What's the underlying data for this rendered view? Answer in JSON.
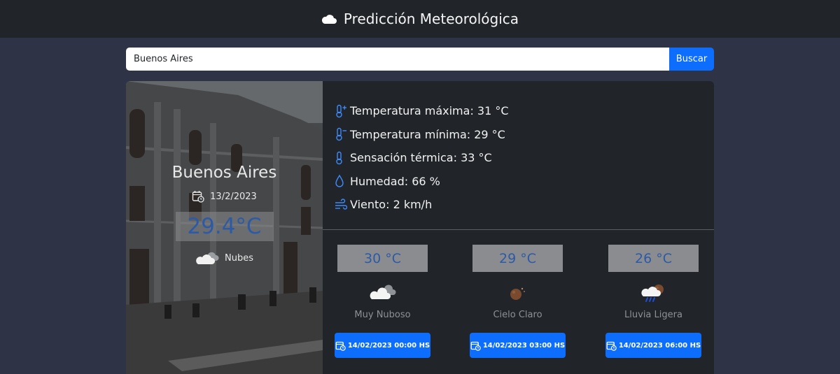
{
  "header": {
    "title": "Predicción Meteorológica",
    "icon": "cloud-icon"
  },
  "search": {
    "value": "Buenos Aires",
    "button_label": "Buscar"
  },
  "current": {
    "city": "Buenos Aires",
    "date": "13/2/2023",
    "temperature": "29.4°C",
    "condition": "Nubes"
  },
  "details": {
    "max_temp": "Temperatura máxima: 31 °C",
    "min_temp": "Temperatura mínima: 29 °C",
    "feels_like": "Sensación térmica: 33 °C",
    "humidity": "Humedad: 66 %",
    "wind": "Viento: 2 km/h"
  },
  "forecast": [
    {
      "temp": "30 °C",
      "desc": "Muy Nuboso",
      "datetime": "14/02/2023 00:00 HS",
      "icon": "broken-clouds-icon"
    },
    {
      "temp": "29 °C",
      "desc": "Cielo Claro",
      "datetime": "14/02/2023 03:00 HS",
      "icon": "clear-night-icon"
    },
    {
      "temp": "26 °C",
      "desc": "Lluvia Ligera",
      "datetime": "14/02/2023 06:00 HS",
      "icon": "light-rain-icon"
    }
  ],
  "colors": {
    "accent": "#0d6efd",
    "icon_blue": "#3d8bfd",
    "background": "#2e3345",
    "card": "#212529"
  }
}
